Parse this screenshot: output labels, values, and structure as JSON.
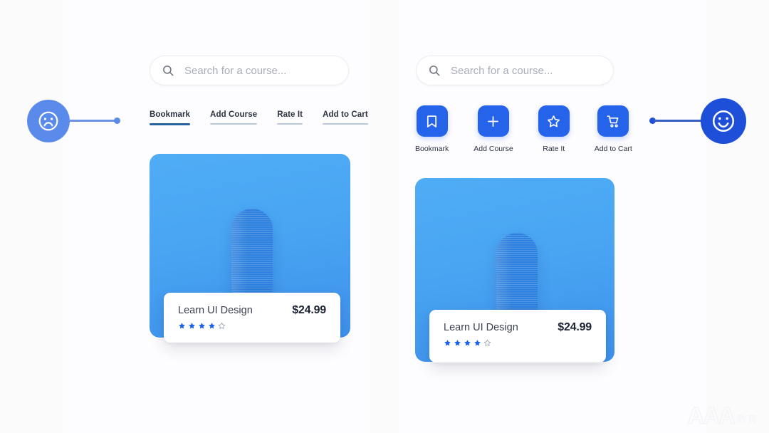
{
  "meta": {
    "background_color": "#fbfbfc",
    "accent_blue": "#2563EB",
    "card_blue_top": "#4FACF5",
    "card_blue_bottom": "#3E91EC",
    "sad_marker_color": "#5B8BEA",
    "happy_marker_color": "#1D4FD8"
  },
  "left_panel": {
    "search": {
      "value": "",
      "placeholder": "Search for a course...",
      "icon": "search-icon"
    },
    "links": [
      {
        "label": "Bookmark",
        "active": true
      },
      {
        "label": "Add Course",
        "active": false
      },
      {
        "label": "Rate It",
        "active": false
      },
      {
        "label": "Add to Cart",
        "active": false
      }
    ],
    "card": {
      "title": "Learn UI Design",
      "price": "$24.99",
      "rating_filled": 4,
      "rating_total": 5
    },
    "marker": {
      "icon": "sad-face-icon",
      "color": "#5B8BEA"
    }
  },
  "right_panel": {
    "search": {
      "value": "",
      "placeholder": "Search for a course...",
      "icon": "search-icon"
    },
    "actions": [
      {
        "label": "Bookmark",
        "icon": "bookmark-icon"
      },
      {
        "label": "Add Course",
        "icon": "plus-icon"
      },
      {
        "label": "Rate It",
        "icon": "star-icon"
      },
      {
        "label": "Add to Cart",
        "icon": "shopping-cart-icon"
      }
    ],
    "card": {
      "title": "Learn UI Design",
      "price": "$24.99",
      "rating_filled": 4,
      "rating_total": 5
    },
    "marker": {
      "icon": "happy-face-icon",
      "color": "#1D4FD8"
    }
  },
  "watermark": {
    "letters": "AAA",
    "chinese": "教育"
  }
}
